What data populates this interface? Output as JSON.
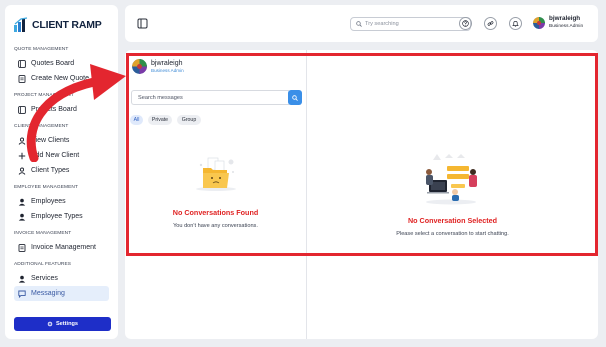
{
  "brand": {
    "name": "CLIENT RAMP"
  },
  "sidebar": {
    "sections": [
      {
        "title": "QUOTE MANAGEMENT",
        "items": [
          {
            "label": "Quotes Board",
            "icon": "board-icon"
          },
          {
            "label": "Create New Quote",
            "icon": "document-icon"
          }
        ]
      },
      {
        "title": "PROJECT MANAGEMENT",
        "items": [
          {
            "label": "Projects Board",
            "icon": "board-icon"
          }
        ]
      },
      {
        "title": "CLIENT MANAGEMENT",
        "items": [
          {
            "label": "View Clients",
            "icon": "user-icon"
          },
          {
            "label": "Add New Client",
            "icon": "plus-icon"
          },
          {
            "label": "Client Types",
            "icon": "user-icon"
          }
        ]
      },
      {
        "title": "EMPLOYEE MANAGEMENT",
        "items": [
          {
            "label": "Employees",
            "icon": "user-icon"
          },
          {
            "label": "Employee Types",
            "icon": "user-icon"
          }
        ]
      },
      {
        "title": "INVOICE MANAGEMENT",
        "items": [
          {
            "label": "Invoice Management",
            "icon": "document-icon"
          }
        ]
      },
      {
        "title": "ADDITIONAL FEATURES",
        "items": [
          {
            "label": "Services",
            "icon": "user-icon"
          },
          {
            "label": "Messaging",
            "icon": "chat-icon",
            "active": true
          }
        ]
      }
    ],
    "settings_label": "Settings"
  },
  "topbar": {
    "search_placeholder": "Try searching",
    "user": {
      "name": "bjwraleigh",
      "role": "Business Admin"
    }
  },
  "messaging": {
    "user": {
      "name": "bjwraleigh",
      "role": "Business Admin"
    },
    "search_placeholder": "Search messages",
    "filters": [
      {
        "label": "All",
        "active": true
      },
      {
        "label": "Private",
        "active": false
      },
      {
        "label": "Group",
        "active": false
      }
    ],
    "empty_list": {
      "title": "No Conversations Found",
      "subtitle": "You don't have any conversations."
    },
    "empty_chat": {
      "title": "No Conversation Selected",
      "subtitle": "Please select a conversation to start chatting."
    }
  },
  "colors": {
    "primary": "#1e2ec8",
    "accent": "#3a8fe8",
    "error": "#e02424",
    "highlight_frame": "#e3262f",
    "active_nav_bg": "#e5eefb"
  }
}
